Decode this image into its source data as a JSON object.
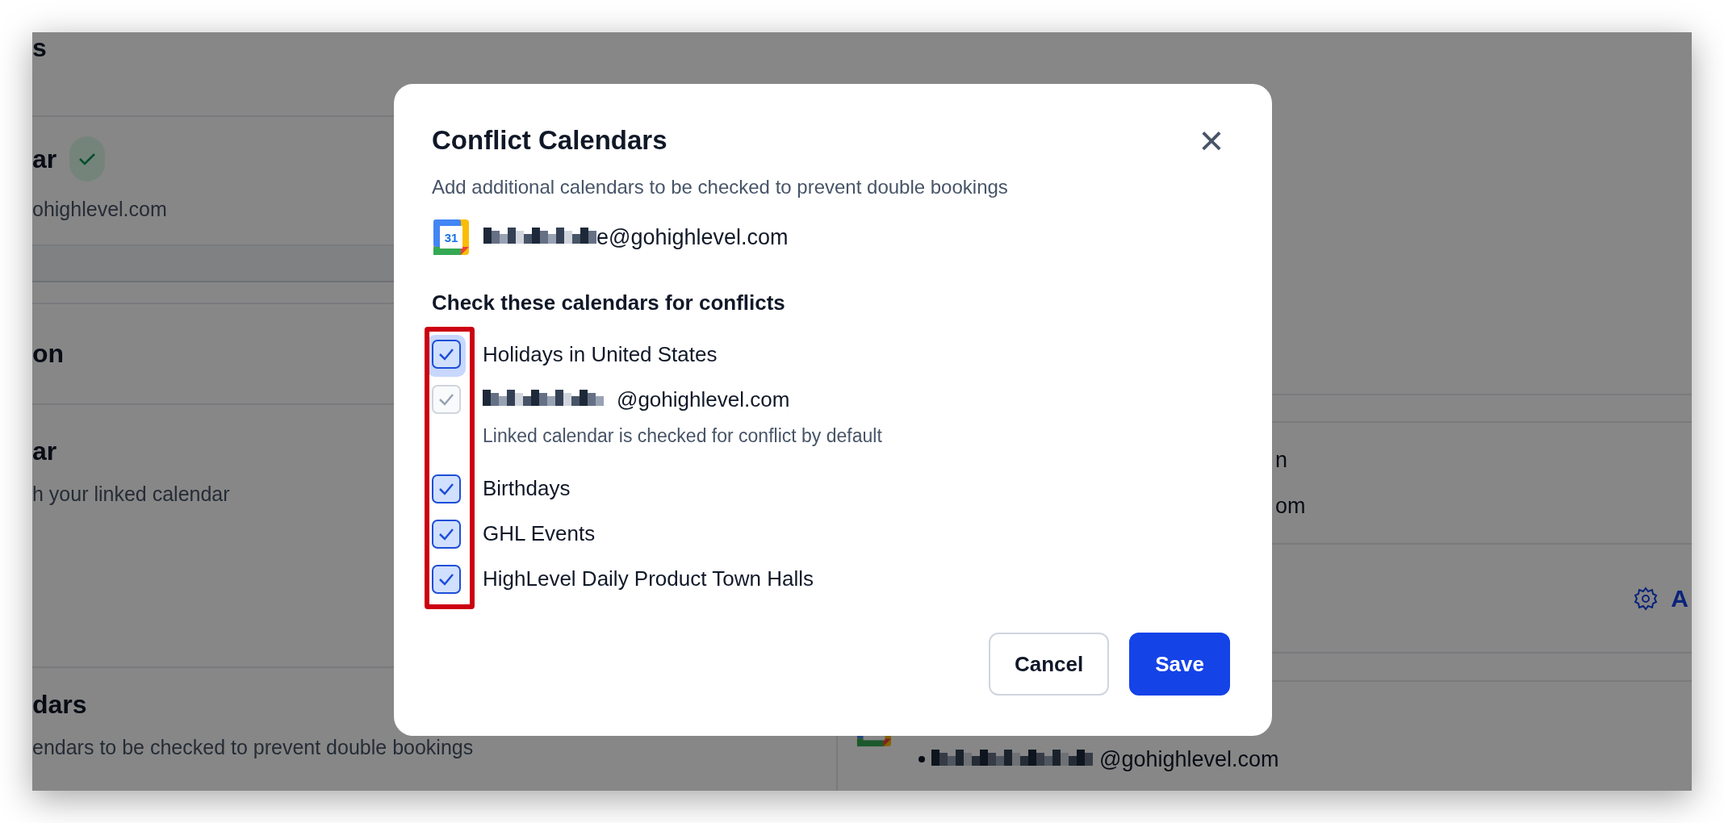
{
  "background_page": {
    "left_sections": [
      {
        "title": "s"
      },
      {
        "title": "ar",
        "verified": true,
        "subtitle": "ohighlevel.com"
      },
      {
        "title": "on"
      },
      {
        "title": "ar",
        "subtitle": "h your linked calendar"
      },
      {
        "title": "dars",
        "subtitle": "endars to be checked to prevent double bookings"
      }
    ],
    "right_lines": [
      "n",
      "om"
    ],
    "right_action": "A",
    "right_bullet_email": "@gohighlevel.com"
  },
  "modal": {
    "title": "Conflict Calendars",
    "close": "×",
    "description": "Add additional calendars to be checked to prevent double bookings",
    "account": {
      "icon_label": "31",
      "email": "e@gohighlevel.com"
    },
    "section_heading": "Check these calendars for conflicts",
    "calendars": [
      {
        "label": "Holidays in United States",
        "checked": true,
        "disabled": false,
        "focused": true
      },
      {
        "label": "@gohighlevel.com",
        "checked": true,
        "disabled": true,
        "focused": false,
        "redacted": true,
        "note": "Linked calendar is checked for conflict by default"
      },
      {
        "label": "Birthdays",
        "checked": true,
        "disabled": false,
        "focused": false
      },
      {
        "label": "GHL Events",
        "checked": true,
        "disabled": false,
        "focused": false
      },
      {
        "label": "HighLevel Daily Product Town Halls",
        "checked": true,
        "disabled": false,
        "focused": false
      }
    ],
    "highlight": true,
    "buttons": [
      {
        "label": "Cancel",
        "kind": "secondary"
      },
      {
        "label": "Save",
        "kind": "primary"
      }
    ]
  }
}
